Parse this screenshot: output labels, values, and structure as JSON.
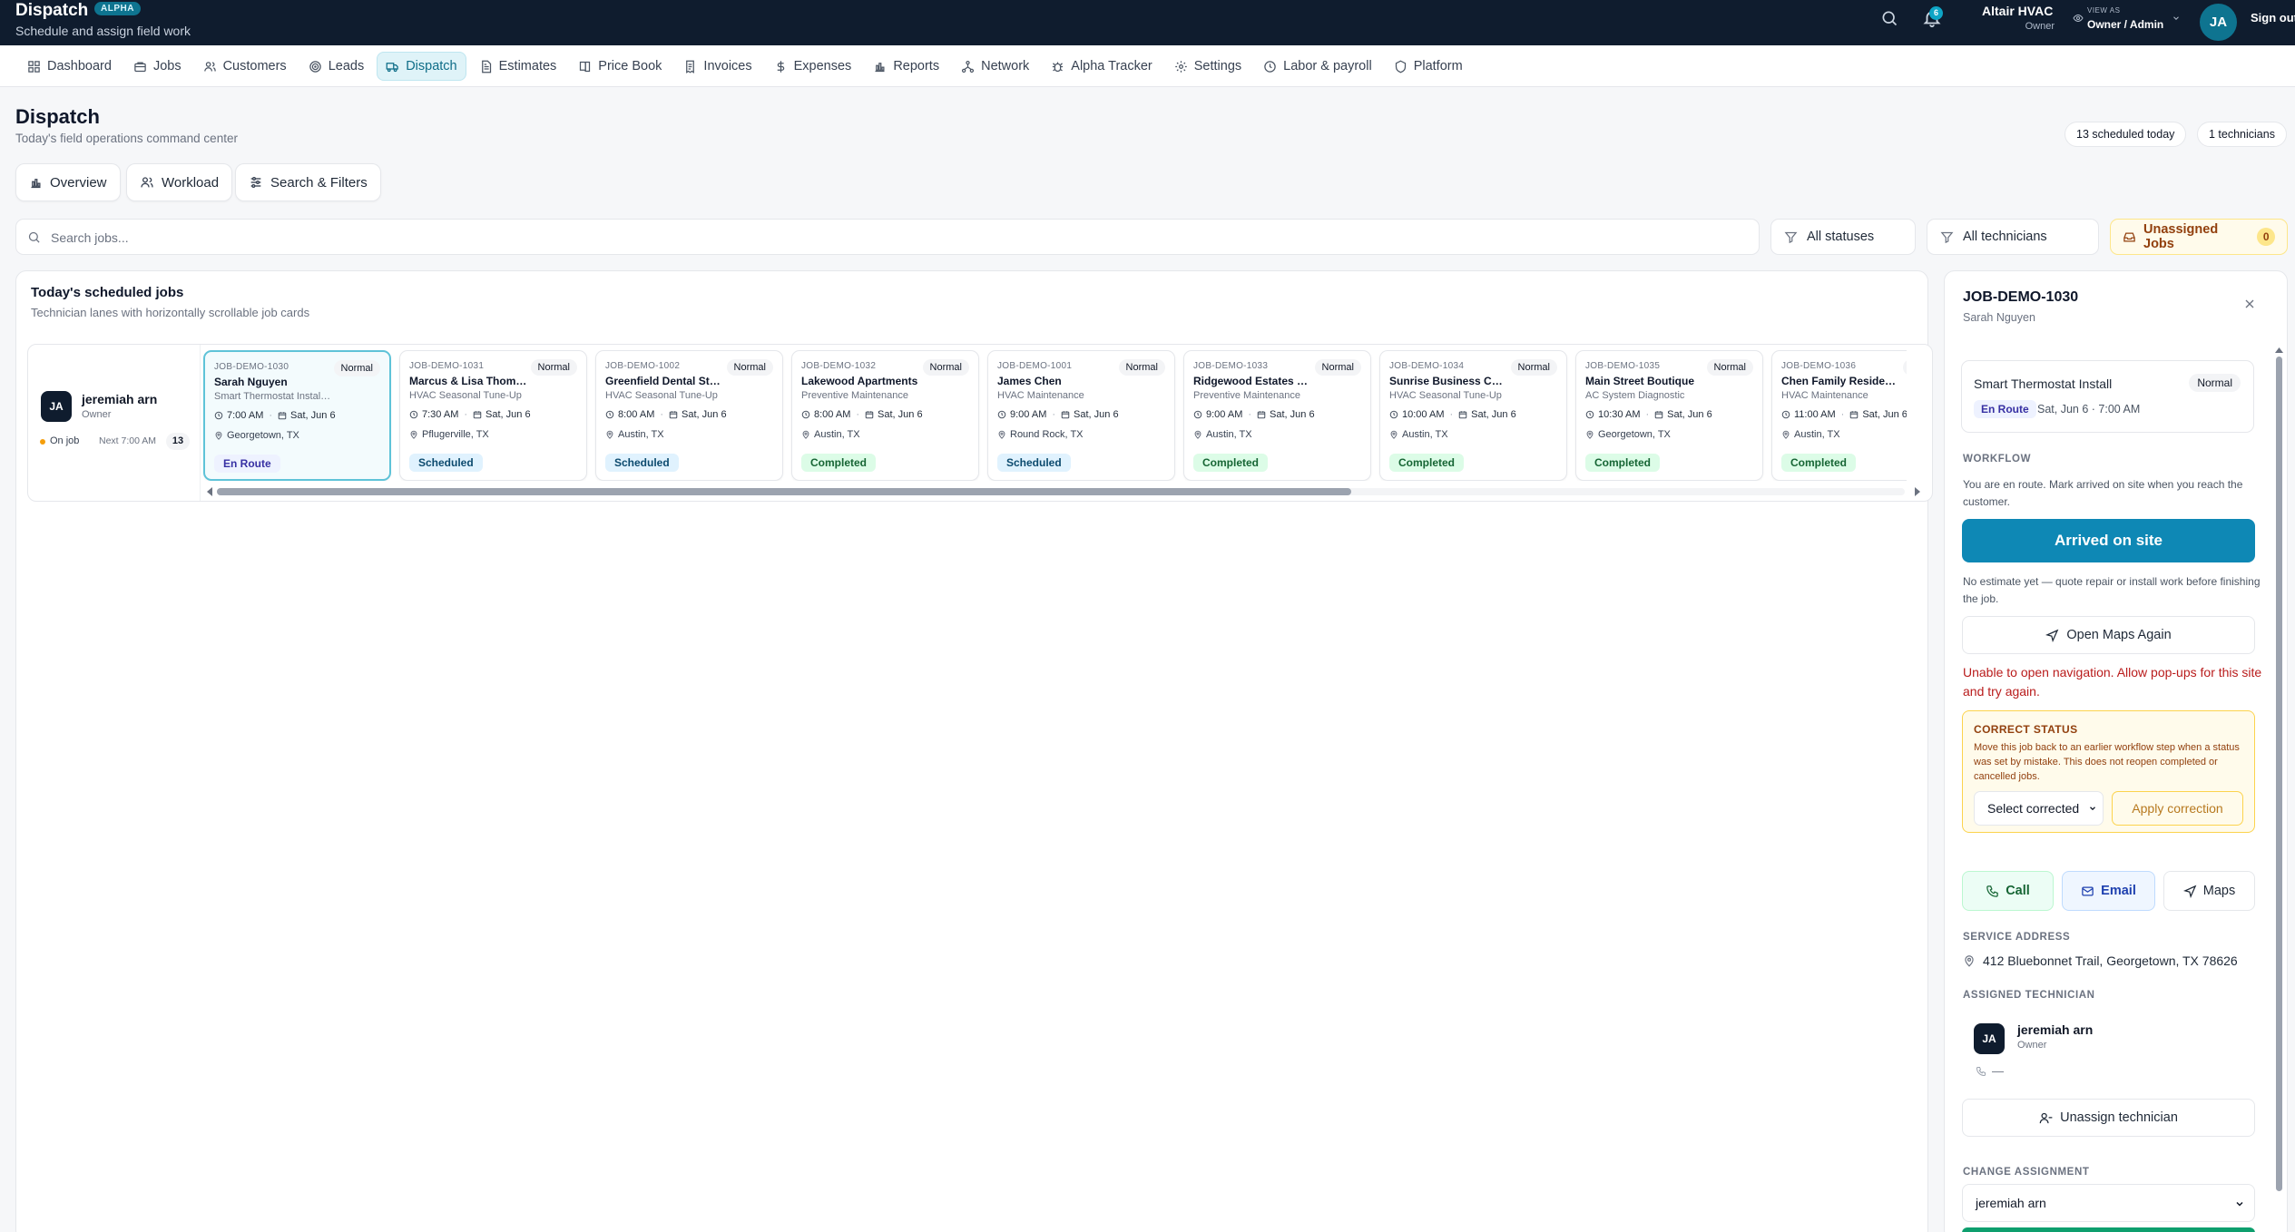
{
  "app": {
    "title": "Dispatch",
    "badge": "ALPHA",
    "subtitle": "Schedule and assign field work",
    "notification_count": "6",
    "company": "Altair HVAC",
    "company_role": "Owner",
    "view_as_label": "VIEW AS",
    "view_as_value": "Owner / Admin",
    "avatar_initials": "JA",
    "sign_out": "Sign out"
  },
  "nav": [
    {
      "label": "Dashboard",
      "icon": "dashboard-icon"
    },
    {
      "label": "Jobs",
      "icon": "briefcase-icon"
    },
    {
      "label": "Customers",
      "icon": "users-icon"
    },
    {
      "label": "Leads",
      "icon": "target-icon"
    },
    {
      "label": "Dispatch",
      "icon": "truck-icon",
      "active": true
    },
    {
      "label": "Estimates",
      "icon": "document-icon"
    },
    {
      "label": "Price Book",
      "icon": "book-icon"
    },
    {
      "label": "Invoices",
      "icon": "receipt-icon"
    },
    {
      "label": "Expenses",
      "icon": "dollar-icon"
    },
    {
      "label": "Reports",
      "icon": "bar-chart-icon"
    },
    {
      "label": "Network",
      "icon": "network-icon"
    },
    {
      "label": "Alpha Tracker",
      "icon": "bug-icon"
    },
    {
      "label": "Settings",
      "icon": "gear-icon"
    },
    {
      "label": "Labor & payroll",
      "icon": "clock-icon"
    },
    {
      "label": "Platform",
      "icon": "shield-icon"
    }
  ],
  "header": {
    "title": "Dispatch",
    "subtitle": "Today's field operations command center",
    "scheduled_pill": "13 scheduled today",
    "technicians_pill": "1 technicians"
  },
  "views": {
    "overview": "Overview",
    "workload": "Workload",
    "search_filters": "Search & Filters"
  },
  "filters": {
    "search_placeholder": "Search jobs...",
    "status": "All statuses",
    "technician": "All technicians",
    "unassigned_label": "Unassigned Jobs",
    "unassigned_count": "0"
  },
  "schedule": {
    "title": "Today's scheduled jobs",
    "subtitle": "Technician lanes with horizontally scrollable job cards",
    "technician": {
      "initials": "JA",
      "name": "jeremiah arn",
      "role": "Owner",
      "status": "On job",
      "next": "Next 7:00 AM",
      "count": "13"
    },
    "jobs": [
      {
        "id": "JOB-DEMO-1030",
        "priority": "Normal",
        "customer": "Sarah Nguyen",
        "service": "Smart Thermostat Installation",
        "time": "7:00 AM",
        "date": "Sat, Jun 6",
        "location": "Georgetown, TX",
        "status": "En Route",
        "status_key": "enroute",
        "selected": true
      },
      {
        "id": "JOB-DEMO-1031",
        "priority": "Normal",
        "customer": "Marcus & Lisa Thompson",
        "service": "HVAC Seasonal Tune-Up",
        "time": "7:30 AM",
        "date": "Sat, Jun 6",
        "location": "Pflugerville, TX",
        "status": "Scheduled",
        "status_key": "scheduled"
      },
      {
        "id": "JOB-DEMO-1002",
        "priority": "Normal",
        "customer": "Greenfield Dental Studio",
        "service": "HVAC Seasonal Tune-Up",
        "time": "8:00 AM",
        "date": "Sat, Jun 6",
        "location": "Austin, TX",
        "status": "Scheduled",
        "status_key": "scheduled"
      },
      {
        "id": "JOB-DEMO-1032",
        "priority": "Normal",
        "customer": "Lakewood Apartments",
        "service": "Preventive Maintenance",
        "time": "8:00 AM",
        "date": "Sat, Jun 6",
        "location": "Austin, TX",
        "status": "Completed",
        "status_key": "completed"
      },
      {
        "id": "JOB-DEMO-1001",
        "priority": "Normal",
        "customer": "James Chen",
        "service": "HVAC Maintenance",
        "time": "9:00 AM",
        "date": "Sat, Jun 6",
        "location": "Round Rock, TX",
        "status": "Scheduled",
        "status_key": "scheduled"
      },
      {
        "id": "JOB-DEMO-1033",
        "priority": "Normal",
        "customer": "Ridgewood Estates HOA",
        "service": "Preventive Maintenance",
        "time": "9:00 AM",
        "date": "Sat, Jun 6",
        "location": "Austin, TX",
        "status": "Completed",
        "status_key": "completed"
      },
      {
        "id": "JOB-DEMO-1034",
        "priority": "Normal",
        "customer": "Sunrise Business Center",
        "service": "HVAC Seasonal Tune-Up",
        "time": "10:00 AM",
        "date": "Sat, Jun 6",
        "location": "Austin, TX",
        "status": "Completed",
        "status_key": "completed"
      },
      {
        "id": "JOB-DEMO-1035",
        "priority": "Normal",
        "customer": "Main Street Boutique",
        "service": "AC System Diagnostic",
        "time": "10:30 AM",
        "date": "Sat, Jun 6",
        "location": "Georgetown, TX",
        "status": "Completed",
        "status_key": "completed"
      },
      {
        "id": "JOB-DEMO-1036",
        "priority": "Normal",
        "customer": "Chen Family Residence",
        "service": "HVAC Maintenance",
        "time": "11:00 AM",
        "date": "Sat, Jun 6",
        "location": "Austin, TX",
        "status": "Completed",
        "status_key": "completed"
      }
    ]
  },
  "detail": {
    "id": "JOB-DEMO-1030",
    "customer": "Sarah Nguyen",
    "service": "Smart Thermostat Install",
    "priority": "Normal",
    "status": "En Route",
    "when": "Sat, Jun 6 · 7:00 AM",
    "workflow_label": "WORKFLOW",
    "workflow_text": "You are en route. Mark arrived on site when you reach the customer.",
    "arrived_button": "Arrived on site",
    "estimate_note": "No estimate yet — quote repair or install work before finishing the job.",
    "open_maps_button": "Open Maps Again",
    "nav_error": "Unable to open navigation. Allow pop-ups for this site and try again.",
    "correct_title": "CORRECT STATUS",
    "correct_text": "Move this job back to an earlier workflow step when a status was set by mistake. This does not reopen completed or cancelled jobs.",
    "correct_select": "Select corrected",
    "apply_button": "Apply correction",
    "call_button": "Call",
    "email_button": "Email",
    "maps_button": "Maps",
    "service_address_label": "SERVICE ADDRESS",
    "service_address": "412 Bluebonnet Trail, Georgetown, TX 78626",
    "assigned_label": "ASSIGNED TECHNICIAN",
    "tech_initials": "JA",
    "tech_name": "jeremiah arn",
    "tech_role": "Owner",
    "tech_phone": "—",
    "unassign_button": "Unassign technician",
    "change_label": "CHANGE ASSIGNMENT",
    "change_value": "jeremiah arn"
  }
}
